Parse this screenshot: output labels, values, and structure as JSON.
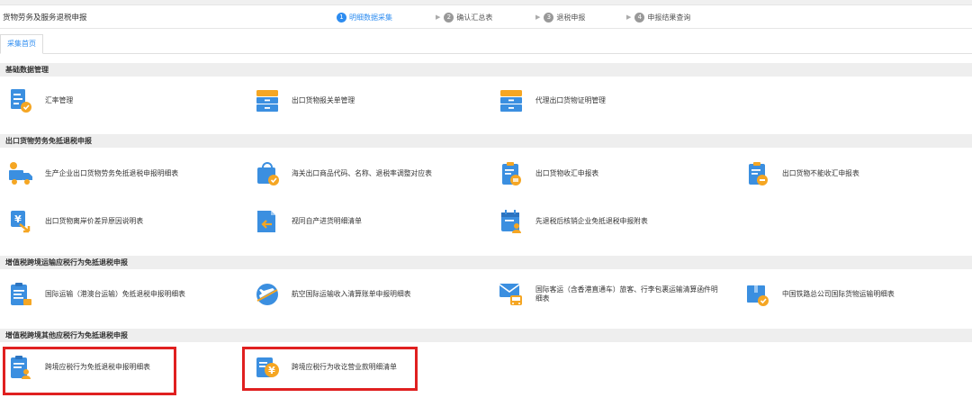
{
  "header": {
    "title": "货物劳务及服务退税申报",
    "steps": [
      {
        "num": "1",
        "label": "明细数据采集"
      },
      {
        "num": "2",
        "label": "确认汇总表"
      },
      {
        "num": "3",
        "label": "退税申报"
      },
      {
        "num": "4",
        "label": "申报结果查询"
      }
    ]
  },
  "tabs": [
    {
      "label": "采集首页"
    }
  ],
  "sections": [
    {
      "title": "基础数据管理",
      "items": [
        {
          "label": "汇率管理",
          "icon": "document-edit-icon"
        },
        {
          "label": "出口货物报关单管理",
          "icon": "filing-cabinet-icon"
        },
        {
          "label": "代理出口货物证明管理",
          "icon": "filing-cabinet-icon"
        }
      ]
    },
    {
      "title": "出口货物劳务免抵退税申报",
      "items": [
        {
          "label": "生产企业出口货物劳务免抵退税申报明细表",
          "icon": "delivery-truck-icon"
        },
        {
          "label": "海关出口商品代码、名称、退税率调整对应表",
          "icon": "shopping-bag-icon"
        },
        {
          "label": "出口货物收汇申报表",
          "icon": "clipboard-exchange-icon"
        },
        {
          "label": "出口货物不能收汇申报表",
          "icon": "clipboard-minus-icon"
        },
        {
          "label": "出口货物离岸价差异原因说明表",
          "icon": "yen-arrow-icon"
        },
        {
          "label": "视同自产进货明细清单",
          "icon": "document-return-icon"
        },
        {
          "label": "先退税后核销企业免抵退税申报附表",
          "icon": "calendar-user-icon"
        }
      ]
    },
    {
      "title": "增值税跨境运输应税行为免抵退税申报",
      "items": [
        {
          "label": "国际运输（港澳台运输）免抵退税申报明细表",
          "icon": "clipboard-list-icon"
        },
        {
          "label": "航空国际运输收入清算账单申报明细表",
          "icon": "airplane-icon"
        },
        {
          "label": "国际客运（含香港直通车）旅客、行李包裹运输清算函件明细表",
          "icon": "mail-bus-icon"
        },
        {
          "label": "中国铁路总公司国际货物运输明细表",
          "icon": "package-check-icon"
        }
      ]
    },
    {
      "title": "增值税跨境其他应税行为免抵退税申报",
      "items": [
        {
          "label": "跨境应税行为免抵退税申报明细表",
          "icon": "clipboard-user-icon"
        },
        {
          "label": "跨境应税行为收讫营业款明细清单",
          "icon": "yen-document-icon"
        }
      ]
    }
  ],
  "colors": {
    "accent": "#2d8cf0",
    "highlight": "#e02020",
    "icon_blue": "#3b8fe0",
    "icon_orange": "#f5a623"
  }
}
